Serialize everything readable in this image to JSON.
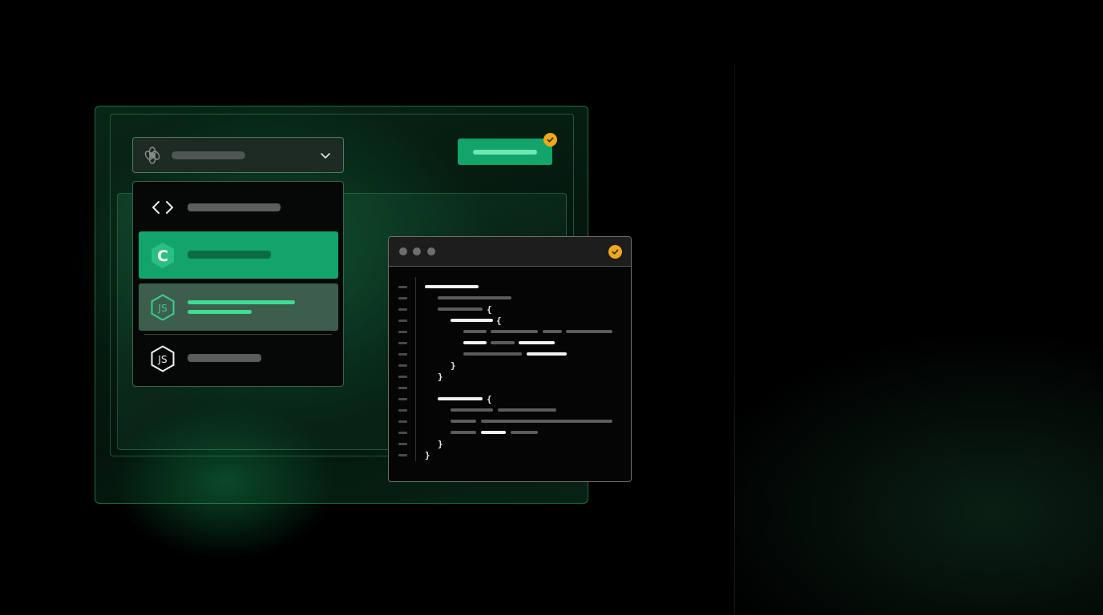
{
  "palette": {
    "background": "#000000",
    "accent_green": "#12a46a",
    "accent_green_light": "#6ee7b0",
    "check_badge": "#f0a81e",
    "highlight_row": "#3e5e4d"
  },
  "model_select": {
    "icon": "openai-logo-icon",
    "selected_label": "",
    "chevron_icon": "chevron-down-icon"
  },
  "apply_button": {
    "label": "",
    "status_icon": "check-badge-icon"
  },
  "dropdown": {
    "items": [
      {
        "icon": "code-brackets-icon",
        "label": "",
        "state": "default"
      },
      {
        "icon": "c-language-icon",
        "label": "",
        "state": "selected"
      },
      {
        "icon": "nodejs-icon",
        "label": "",
        "state": "hover"
      },
      {
        "icon": "nodejs-icon",
        "label": "",
        "state": "default"
      }
    ]
  },
  "editor": {
    "window_controls": [
      "window-dot-icon",
      "window-dot-icon",
      "window-dot-icon"
    ],
    "status_icon": "check-badge-icon",
    "braces": [
      "{",
      "{",
      "}",
      "}",
      "{",
      "}",
      "}"
    ]
  }
}
